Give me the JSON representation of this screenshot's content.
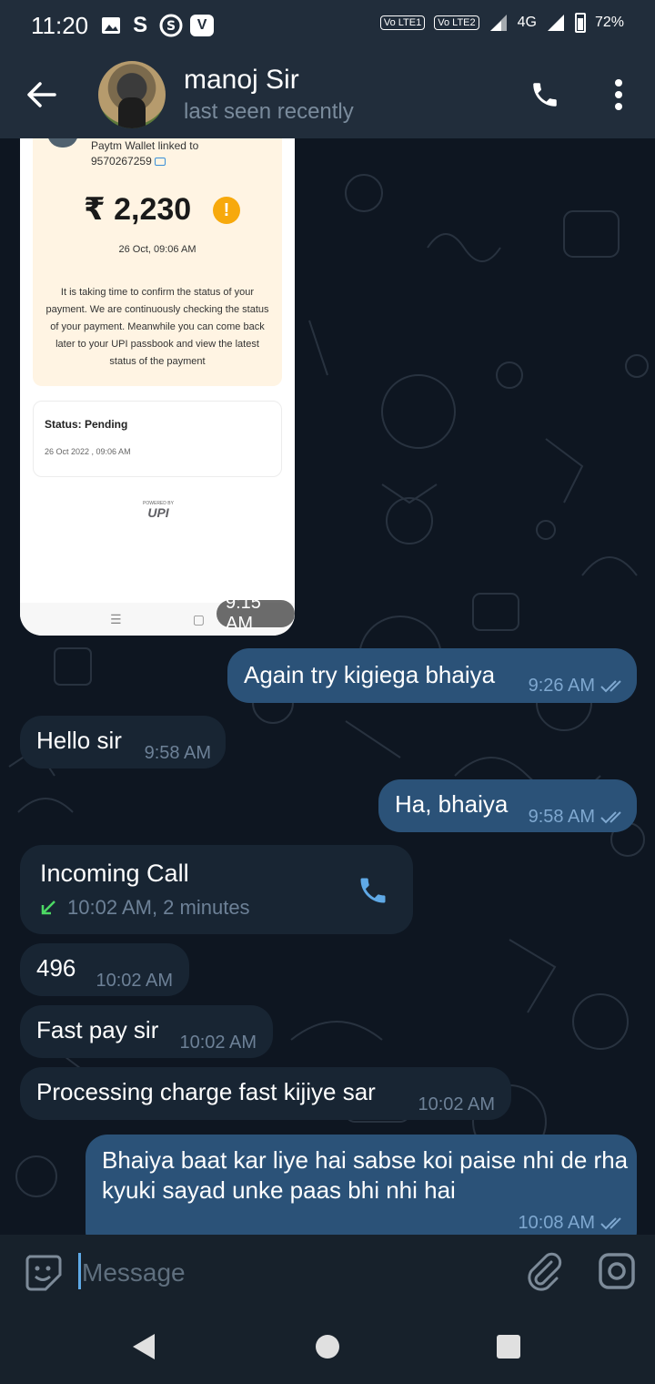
{
  "status_bar": {
    "time": "11:20",
    "left_icons": [
      "gallery-icon",
      "s-icon",
      "s-circle-icon",
      "v-icon"
    ],
    "volte1": "Vo LTE1",
    "volte2": "Vo LTE2",
    "network": "4G",
    "battery": "72%"
  },
  "header": {
    "contact_name": "manoj Sir",
    "last_seen": "last seen recently",
    "icons": [
      "back-arrow-icon",
      "phone-icon",
      "more-vert-icon"
    ]
  },
  "messages": {
    "screenshot": {
      "wallet_line1": "Paytm Wallet linked to",
      "wallet_line2": "9570267259",
      "amount": "₹ 2,230",
      "warn_symbol": "!",
      "date": "26 Oct, 09:06 AM",
      "description": "It is taking time to confirm the status of your payment. We are continuously checking the status of your payment. Meanwhile you can come back later to your UPI passbook and view the latest status of the payment",
      "status_label": "Status: Pending",
      "status_date": "26 Oct 2022 , 09:06 AM",
      "upi_powered": "POWERED BY",
      "upi_word": "UPI",
      "nav_menu": "☰",
      "nav_home": "▢",
      "time": "9:15 AM"
    },
    "m1": {
      "text": "Again try kigiega bhaiya",
      "time": "9:26 AM",
      "direction": "out"
    },
    "m2": {
      "text": "Hello sir",
      "time": "9:58 AM",
      "direction": "in"
    },
    "m3": {
      "text": "Ha, bhaiya",
      "time": "9:58 AM",
      "direction": "out"
    },
    "call": {
      "title": "Incoming Call",
      "detail": "10:02 AM, 2 minutes",
      "direction": "in"
    },
    "m4": {
      "text": "496",
      "time": "10:02 AM",
      "direction": "in"
    },
    "m5": {
      "text": "Fast pay sir",
      "time": "10:02 AM",
      "direction": "in"
    },
    "m6": {
      "text": "Processing charge fast kijiye sar",
      "time": "10:02 AM",
      "direction": "in"
    },
    "m7": {
      "text": "Bhaiya baat kar liye hai sabse koi paise nhi de rha kyuki sayad unke paas bhi nhi hai",
      "time": "10:08 AM",
      "direction": "out"
    }
  },
  "input": {
    "placeholder": "Message",
    "icons": [
      "sticker-emoji-icon",
      "paperclip-icon",
      "camera-icon"
    ]
  },
  "colors": {
    "header_bg": "#212d3b",
    "chat_bg": "#0e1621",
    "incoming_bubble": "#182533",
    "outgoing_bubble": "#2b5278",
    "accent": "#5fa9e6",
    "call_arrow": "#4cd964"
  }
}
